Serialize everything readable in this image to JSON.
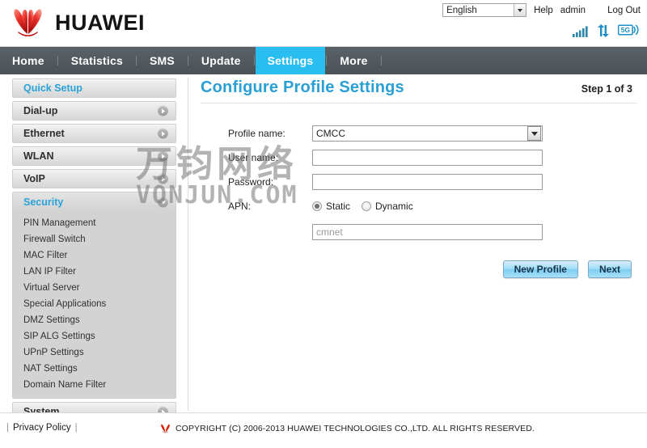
{
  "header": {
    "brand": "HUAWEI",
    "language": {
      "value": "English",
      "options": [
        "English"
      ]
    },
    "help_label": "Help",
    "user_label": "admin",
    "logout_label": "Log Out",
    "status_icons": [
      "signal-bars-icon",
      "data-transfer-icon",
      "network-5g-icon"
    ]
  },
  "nav": {
    "items": [
      {
        "label": "Home",
        "active": false
      },
      {
        "label": "Statistics",
        "active": false
      },
      {
        "label": "SMS",
        "active": false
      },
      {
        "label": "Update",
        "active": false
      },
      {
        "label": "Settings",
        "active": true
      },
      {
        "label": "More",
        "active": false
      }
    ]
  },
  "sidebar": {
    "groups": [
      {
        "label": "Quick Setup",
        "accent": true,
        "arrow": "none",
        "expanded": false,
        "children": []
      },
      {
        "label": "Dial-up",
        "accent": false,
        "arrow": "right",
        "expanded": false,
        "children": []
      },
      {
        "label": "Ethernet",
        "accent": false,
        "arrow": "right",
        "expanded": false,
        "children": []
      },
      {
        "label": "WLAN",
        "accent": false,
        "arrow": "right",
        "expanded": false,
        "children": []
      },
      {
        "label": "VoIP",
        "accent": false,
        "arrow": "right",
        "expanded": false,
        "children": []
      },
      {
        "label": "Security",
        "accent": true,
        "arrow": "down",
        "expanded": true,
        "children": [
          "PIN Management",
          "Firewall Switch",
          "MAC Filter",
          "LAN IP Filter",
          "Virtual Server",
          "Special Applications",
          "DMZ Settings",
          "SIP ALG Settings",
          "UPnP Settings",
          "NAT Settings",
          "Domain Name Filter"
        ]
      },
      {
        "label": "System",
        "accent": false,
        "arrow": "right",
        "expanded": false,
        "children": []
      }
    ]
  },
  "content": {
    "title": "Configure Profile Settings",
    "step": "Step 1 of 3",
    "fields": {
      "profile_name": {
        "label": "Profile name:",
        "value": "CMCC",
        "options": [
          "CMCC"
        ]
      },
      "user_name": {
        "label": "User name:",
        "value": "",
        "placeholder": ""
      },
      "password": {
        "label": "Password:",
        "value": "",
        "placeholder": ""
      },
      "apn": {
        "label": "APN:",
        "mode": "Static",
        "options": [
          {
            "label": "Static",
            "selected": true
          },
          {
            "label": "Dynamic",
            "selected": false
          }
        ],
        "value": "",
        "placeholder": "cmnet"
      }
    },
    "buttons": {
      "new_profile": "New Profile",
      "next": "Next"
    }
  },
  "watermark": {
    "chinese": "万钧网络",
    "latin": "VONJUN.COM"
  },
  "footer": {
    "privacy_label": "Privacy Policy",
    "copyright": "COPYRIGHT (C) 2006-2013 HUAWEI TECHNOLOGIES CO.,LTD. ALL RIGHTS RESERVED."
  },
  "colors": {
    "accent_blue": "#29bdf0",
    "title_blue": "#2a9fd4",
    "nav_dark": "#4b5156",
    "brand_red": "#d81e06"
  }
}
